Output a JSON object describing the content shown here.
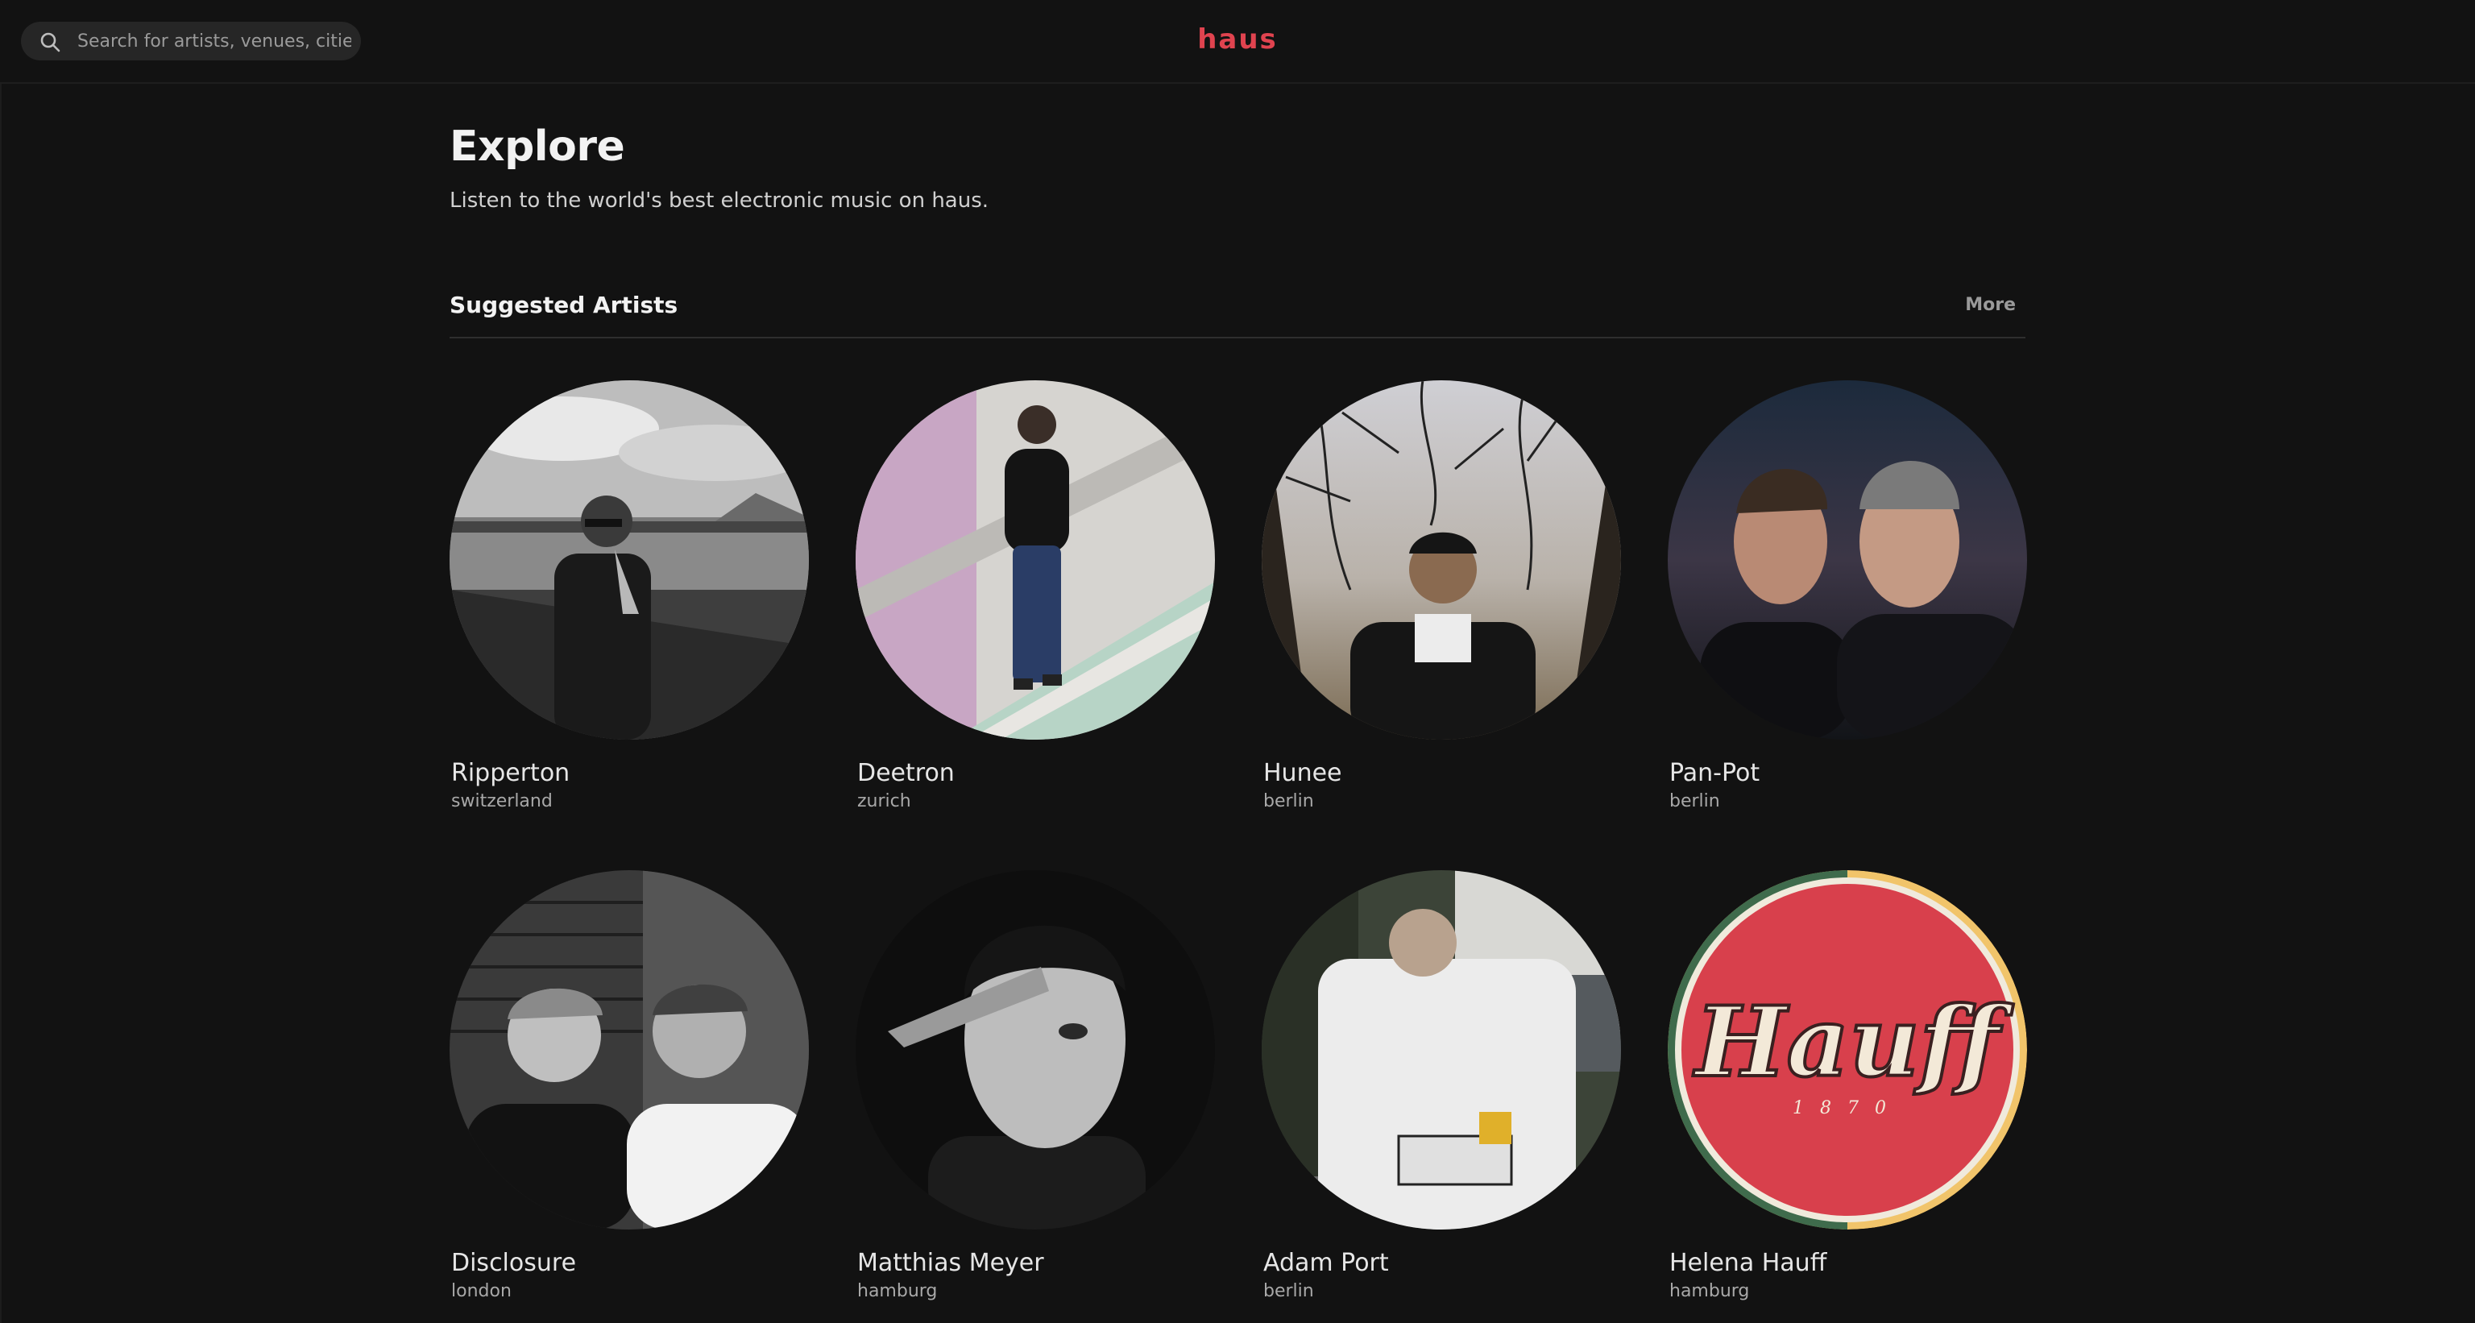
{
  "header": {
    "search_placeholder": "Search for artists, venues, cities",
    "logo_text": "haus",
    "logo_color": "#e0434f"
  },
  "page": {
    "title": "Explore",
    "subtitle": "Listen to the world's best electronic music on haus."
  },
  "section": {
    "title": "Suggested Artists",
    "more_label": "More"
  },
  "artists": [
    {
      "name": "Ripperton",
      "city": "switzerland"
    },
    {
      "name": "Deetron",
      "city": "zurich"
    },
    {
      "name": "Hunee",
      "city": "berlin"
    },
    {
      "name": "Pan-Pot",
      "city": "berlin"
    },
    {
      "name": "Disclosure",
      "city": "london"
    },
    {
      "name": "Matthias Meyer",
      "city": "hamburg"
    },
    {
      "name": "Adam Port",
      "city": "berlin"
    },
    {
      "name": "Helena Hauff",
      "city": "hamburg",
      "photo_text": "Hauff",
      "photo_subtext": "1870"
    }
  ]
}
